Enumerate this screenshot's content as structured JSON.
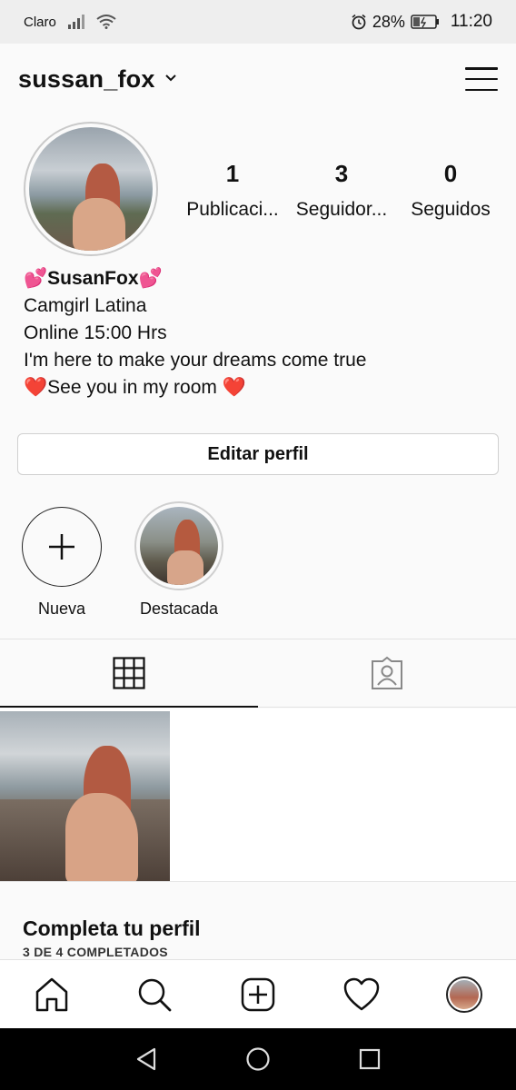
{
  "status_bar": {
    "carrier": "Claro",
    "battery_percent": "28%",
    "time": "11:20"
  },
  "header": {
    "username": "sussan_fox"
  },
  "stats": [
    {
      "value": "1",
      "label": "Publicaci..."
    },
    {
      "value": "3",
      "label": "Seguidor..."
    },
    {
      "value": "0",
      "label": "Seguidos"
    }
  ],
  "bio": {
    "name": "💕SusanFox💕",
    "lines": [
      "Camgirl Latina",
      "Online 15:00 Hrs",
      "I'm here to make your dreams come true",
      "❤️See you in my room ❤️"
    ]
  },
  "edit_profile_label": "Editar perfil",
  "highlights": [
    {
      "label": "Nueva"
    },
    {
      "label": "Destacada"
    }
  ],
  "complete_profile": {
    "title": "Completa tu perfil",
    "subtitle": "3 DE 4 COMPLETADOS"
  },
  "icons": {
    "menu": "hamburger-menu-icon",
    "grid": "grid-icon",
    "tagged": "tagged-person-icon",
    "home": "home-icon",
    "search": "search-icon",
    "add": "add-post-icon",
    "activity": "heart-icon"
  }
}
